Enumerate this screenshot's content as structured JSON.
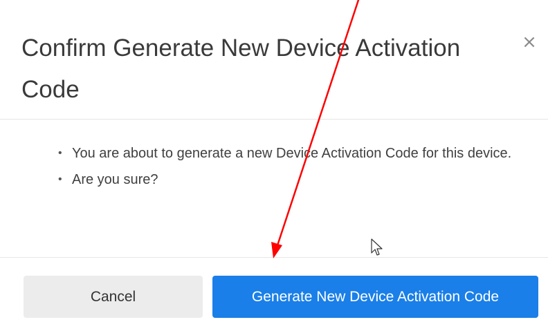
{
  "dialog": {
    "title": "Confirm Generate New Device Activation Code",
    "close_symbol": "×",
    "bullets": [
      "You are about to generate a new Device Activation Code for this device.",
      "Are you sure?"
    ],
    "cancel_label": "Cancel",
    "confirm_label": "Generate New Device Activation Code"
  },
  "colors": {
    "primary_button": "#1a7fe8",
    "cancel_button": "#ececec",
    "annotation_arrow": "#ff0000"
  },
  "icons": {
    "close": "close-icon",
    "cursor": "mouse-pointer-icon",
    "annotation": "red-arrow-icon"
  }
}
